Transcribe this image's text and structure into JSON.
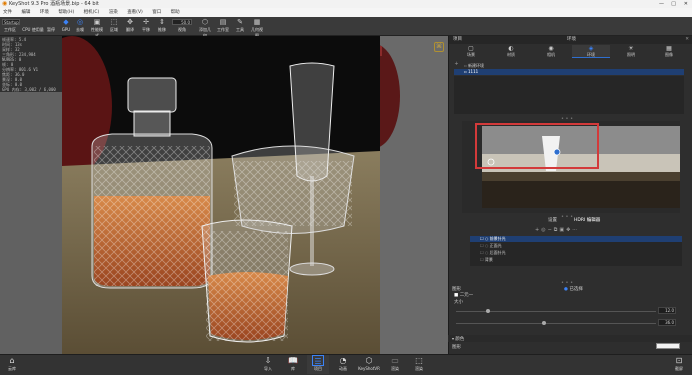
{
  "window": {
    "title": "KeyShot 9.3 Pro  酒瓶场景.bip - 64 bit",
    "min": "—",
    "max": "□",
    "close": "✕"
  },
  "menu": [
    "文件",
    "编辑",
    "环境",
    "帮助(H)",
    "相机(C)",
    "渲染",
    "查看(V)",
    "窗口",
    "帮助"
  ],
  "toolbar": {
    "preset": "Startup",
    "items": [
      {
        "label": "工作区",
        "icon": "workspace-icon"
      },
      {
        "label": "CPU 使用量",
        "icon": "cpu-icon"
      },
      {
        "label": "暂停",
        "icon": "pause-icon"
      },
      {
        "label": "GPU",
        "icon": "gpu-icon"
      },
      {
        "label": "去噪",
        "icon": "denoise-icon"
      },
      {
        "label": "性能模式",
        "icon": "performance-icon"
      },
      {
        "label": "区域",
        "icon": "region-icon"
      },
      {
        "label": "翻译",
        "icon": "translate-icon"
      },
      {
        "label": "平移",
        "icon": "pan-icon"
      },
      {
        "label": "推移",
        "icon": "dolly-icon"
      },
      {
        "label": "视角",
        "icon": "view-icon"
      },
      {
        "label": "添加几何",
        "icon": "add-geometry-icon"
      },
      {
        "label": "工作室",
        "icon": "studio-icon"
      },
      {
        "label": "工具",
        "icon": "tools-icon"
      },
      {
        "label": "几何视图",
        "icon": "geometry-view-icon"
      }
    ],
    "zoom": "50.0"
  },
  "stats": {
    "lines": [
      "帧速率:  5.4",
      "时间:   13s",
      "采样:   32",
      "三角形: 234,984",
      "NURBS:  0",
      "帧:    0",
      "分辨率: 801.6 V1",
      "焦距:   36.0",
      "景深:   0.0",
      "坐标:   0.0",
      "",
      "GPU 内存: 3,002 / 6,000"
    ]
  },
  "panel": {
    "header_left": "项目",
    "header_center": "环境",
    "tabs": [
      {
        "label": "场景",
        "icon": "scene-icon"
      },
      {
        "label": "材质",
        "icon": "material-icon"
      },
      {
        "label": "相机",
        "icon": "camera-icon"
      },
      {
        "label": "环境",
        "icon": "environment-icon"
      },
      {
        "label": "照明",
        "icon": "lighting-icon"
      },
      {
        "label": "图像",
        "icon": "image-icon"
      }
    ],
    "env_items": [
      "新建环境",
      "1111"
    ],
    "hdri_tab_left": "设置",
    "hdri_tab_right": "HDRI 编辑器",
    "pins": [
      "前景针光",
      "正面光",
      "后面针光",
      "背景"
    ],
    "props": {
      "label_type": "图形",
      "label_bg": "已选择",
      "label_color": "颜色",
      "checkbox": "二元一",
      "slider1_value": "12.0",
      "slider2_value": "36.0",
      "section": "大小",
      "footer": "图形"
    }
  },
  "bottom": {
    "left": {
      "label": "云库",
      "icon": "cloud-library-icon"
    },
    "buttons": [
      {
        "label": "导入",
        "icon": "import-icon"
      },
      {
        "label": "库",
        "icon": "library-icon"
      },
      {
        "label": "项目",
        "icon": "project-icon"
      },
      {
        "label": "动画",
        "icon": "animation-icon"
      },
      {
        "label": "KeyShotVR",
        "icon": "keyshotvr-icon"
      },
      {
        "label": "渲染",
        "icon": "render-icon"
      },
      {
        "label": "渲染",
        "icon": "render-queue-icon"
      }
    ],
    "right": {
      "label": "截屏",
      "icon": "screenshot-icon"
    }
  },
  "colors": {
    "accent": "#2f6fcf",
    "selection": "#1f3f73",
    "highlight_box": "#d33a3a",
    "amber": "#c8662a"
  }
}
